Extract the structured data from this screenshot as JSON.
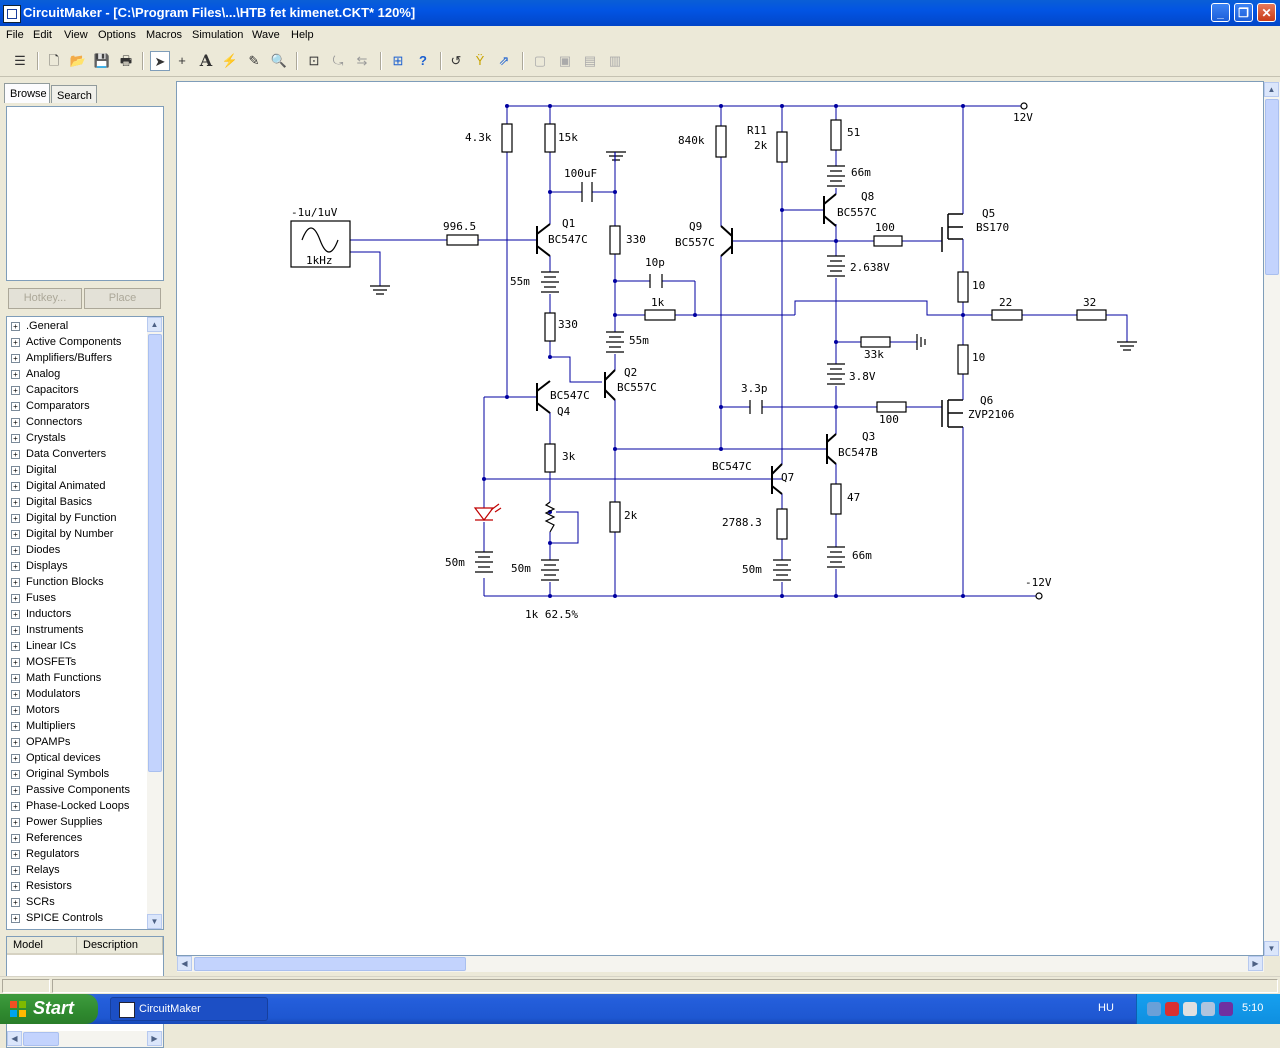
{
  "window": {
    "title": "CircuitMaker - [C:\\Program Files\\...\\HTB fet kimenet.CKT* 120%]",
    "minimize": "_",
    "restore": "❐",
    "close": "✕"
  },
  "menu": [
    "File",
    "Edit",
    "View",
    "Options",
    "Macros",
    "Simulation",
    "Wave",
    "Help"
  ],
  "left_panel": {
    "tabs": [
      "Browse",
      "Search"
    ],
    "active_tab": "Browse",
    "buttons": {
      "hotkey": "Hotkey...",
      "place": "Place"
    },
    "tree_items": [
      ".General",
      "Active Components",
      "Amplifiers/Buffers",
      "Analog",
      "Capacitors",
      "Comparators",
      "Connectors",
      "Crystals",
      "Data Converters",
      "Digital",
      "Digital Animated",
      "Digital Basics",
      "Digital by Function",
      "Digital by Number",
      "Diodes",
      "Displays",
      "Function Blocks",
      "Fuses",
      "Inductors",
      "Instruments",
      "Linear ICs",
      "MOSFETs",
      "Math Functions",
      "Modulators",
      "Motors",
      "Multipliers",
      "OPAMPs",
      "Optical devices",
      "Original Symbols",
      "Passive Components",
      "Phase-Locked Loops",
      "Power Supplies",
      "References",
      "Regulators",
      "Relays",
      "Resistors",
      "SCRs",
      "SPICE Controls"
    ],
    "model_columns": [
      "Model",
      "Description"
    ]
  },
  "schematic": {
    "labels": {
      "src_amp": "-1u/1uV",
      "src_freq": "1kHz",
      "r_in": "996.5",
      "r_43k": "4.3k",
      "r_15k": "15k",
      "c_100u": "100uF",
      "q1": "Q1",
      "q1_model": "BC547C",
      "r_330a": "330",
      "bat_55m_a": "55m",
      "c_10p": "10p",
      "r_1k": "1k",
      "r_330b": "330",
      "bat_55m_b": "55m",
      "q2": "Q2",
      "q2_model": "BC557C",
      "q4_model": "BC547C",
      "q4": "Q4",
      "r_3k": "3k",
      "r_2k": "2k",
      "bat_50m_a": "50m",
      "bat_50m_b": "50m",
      "pot": "1k 62.5%",
      "r_840k": "840k",
      "q9": "Q9",
      "q9_model": "BC557C",
      "r11": "R11",
      "r11_val": "2k",
      "r_51": "51",
      "bat_66m_a": "66m",
      "q8": "Q8",
      "q8_model": "BC557C",
      "r_100a": "100",
      "bat_2638": "2.638V",
      "q5": "Q5",
      "q5_model": "BS170",
      "r_10a": "10",
      "r_22": "22",
      "r_32": "32",
      "r_33k": "33k",
      "r_10b": "10",
      "bat_38": "3.8V",
      "c_33p": "3.3p",
      "r_100b": "100",
      "q6": "Q6",
      "q6_model": "ZVP2106",
      "q3": "Q3",
      "q3_model": "BC547B",
      "q7_model": "BC547C",
      "q7": "Q7",
      "r_27883": "2788.3",
      "bat_50m_c": "50m",
      "r_47": "47",
      "bat_66m_b": "66m",
      "vpos": "12V",
      "vneg": "-12V"
    }
  },
  "taskbar": {
    "start": "Start",
    "task": "CircuitMaker",
    "lang": "HU",
    "clock": "5:10"
  }
}
